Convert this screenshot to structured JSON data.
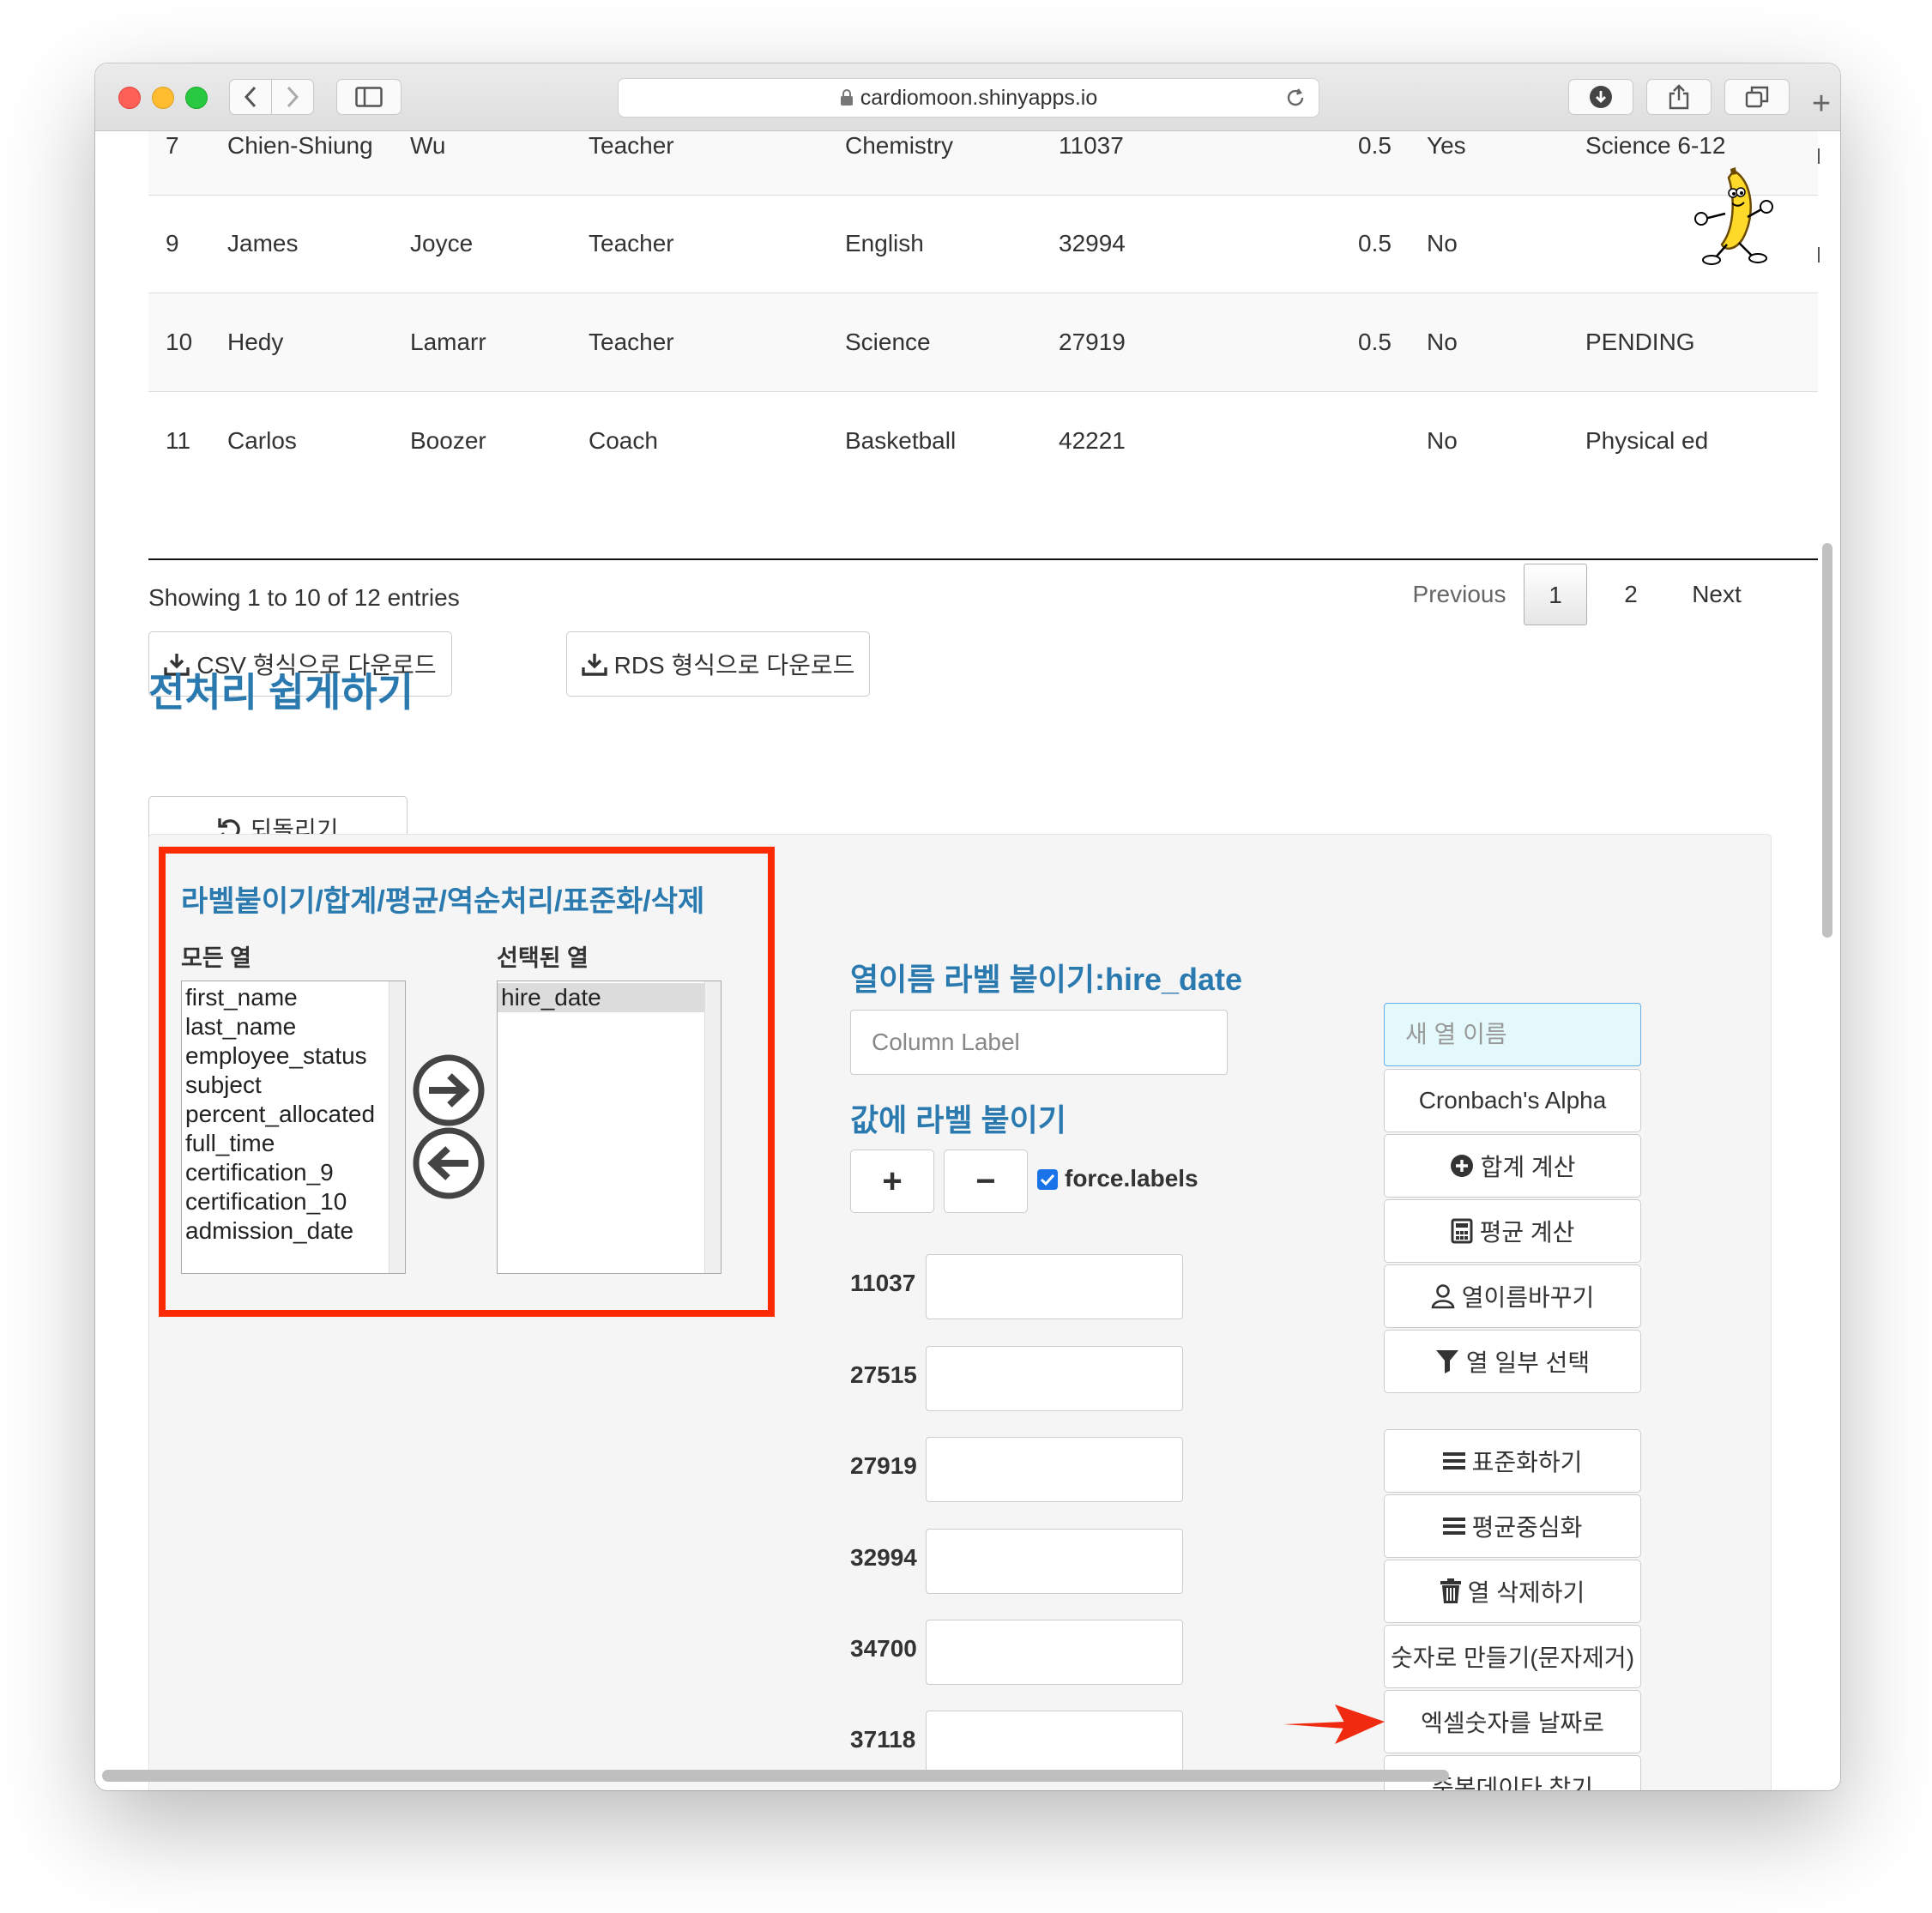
{
  "browser": {
    "url": "cardiomoon.shinyapps.io",
    "new_tab_label": "+"
  },
  "table": {
    "rows": [
      {
        "id": "7",
        "first_name": "Chien-Shiung",
        "last_name": "Wu",
        "status": "Teacher",
        "subject": "Chemistry",
        "hire_date": "11037",
        "percent": "0.5",
        "full_time": "Yes",
        "certification": "Science 6-12"
      },
      {
        "id": "9",
        "first_name": "James",
        "last_name": "Joyce",
        "status": "Teacher",
        "subject": "English",
        "hire_date": "32994",
        "percent": "0.5",
        "full_time": "No",
        "certification": ""
      },
      {
        "id": "10",
        "first_name": "Hedy",
        "last_name": "Lamarr",
        "status": "Teacher",
        "subject": "Science",
        "hire_date": "27919",
        "percent": "0.5",
        "full_time": "No",
        "certification": "PENDING"
      },
      {
        "id": "11",
        "first_name": "Carlos",
        "last_name": "Boozer",
        "status": "Coach",
        "subject": "Basketball",
        "hire_date": "42221",
        "percent": "",
        "full_time": "No",
        "certification": "Physical ed"
      }
    ],
    "info": "Showing 1 to 10 of 12 entries",
    "pagination": {
      "previous": "Previous",
      "pages": [
        "1",
        "2"
      ],
      "current": "1",
      "next": "Next"
    }
  },
  "downloads": {
    "csv_label": "CSV 형식으로 다운로드",
    "rds_label": "RDS 형식으로 다운로드"
  },
  "preprocess": {
    "title": "전처리 쉽게하기",
    "undo_label": "되돌리기"
  },
  "column_selector": {
    "title": "라벨붙이기/합계/평균/역순처리/표준화/삭제",
    "all_label": "모든 열",
    "selected_label": "선택된 열",
    "all_columns": [
      "first_name",
      "last_name",
      "employee_status",
      "subject",
      "percent_allocated",
      "full_time",
      "certification_9",
      "certification_10",
      "admission_date"
    ],
    "selected_columns": [
      "hire_date"
    ]
  },
  "labeling": {
    "column_label_title": "열이름 라벨 붙이기:hire_date",
    "column_label_placeholder": "Column Label",
    "value_label_title": "값에 라벨 붙이기",
    "plus": "+",
    "minus": "−",
    "force_labels": "force.labels",
    "force_labels_checked": true,
    "values": [
      "11037",
      "27515",
      "27919",
      "32994",
      "34700",
      "37118"
    ]
  },
  "actions": {
    "new_col_placeholder": "새 열 이름",
    "cronbach": "Cronbach's Alpha",
    "sum": "합계 계산",
    "mean": "평균 계산",
    "rename": "열이름바꾸기",
    "select": "열 일부 선택",
    "standardize": "표준화하기",
    "center": "평균중심화",
    "delete": "열 삭제하기",
    "to_numeric": "숫자로 만들기(문자제거)",
    "excel_to_date": "엑셀숫자를 날짜로",
    "find_dup": "중복데이타 찾기"
  },
  "colors": {
    "accent_blue": "#2a7ab0",
    "highlight_red": "#ff2a00",
    "new_col_bg": "#e3f9fb"
  }
}
